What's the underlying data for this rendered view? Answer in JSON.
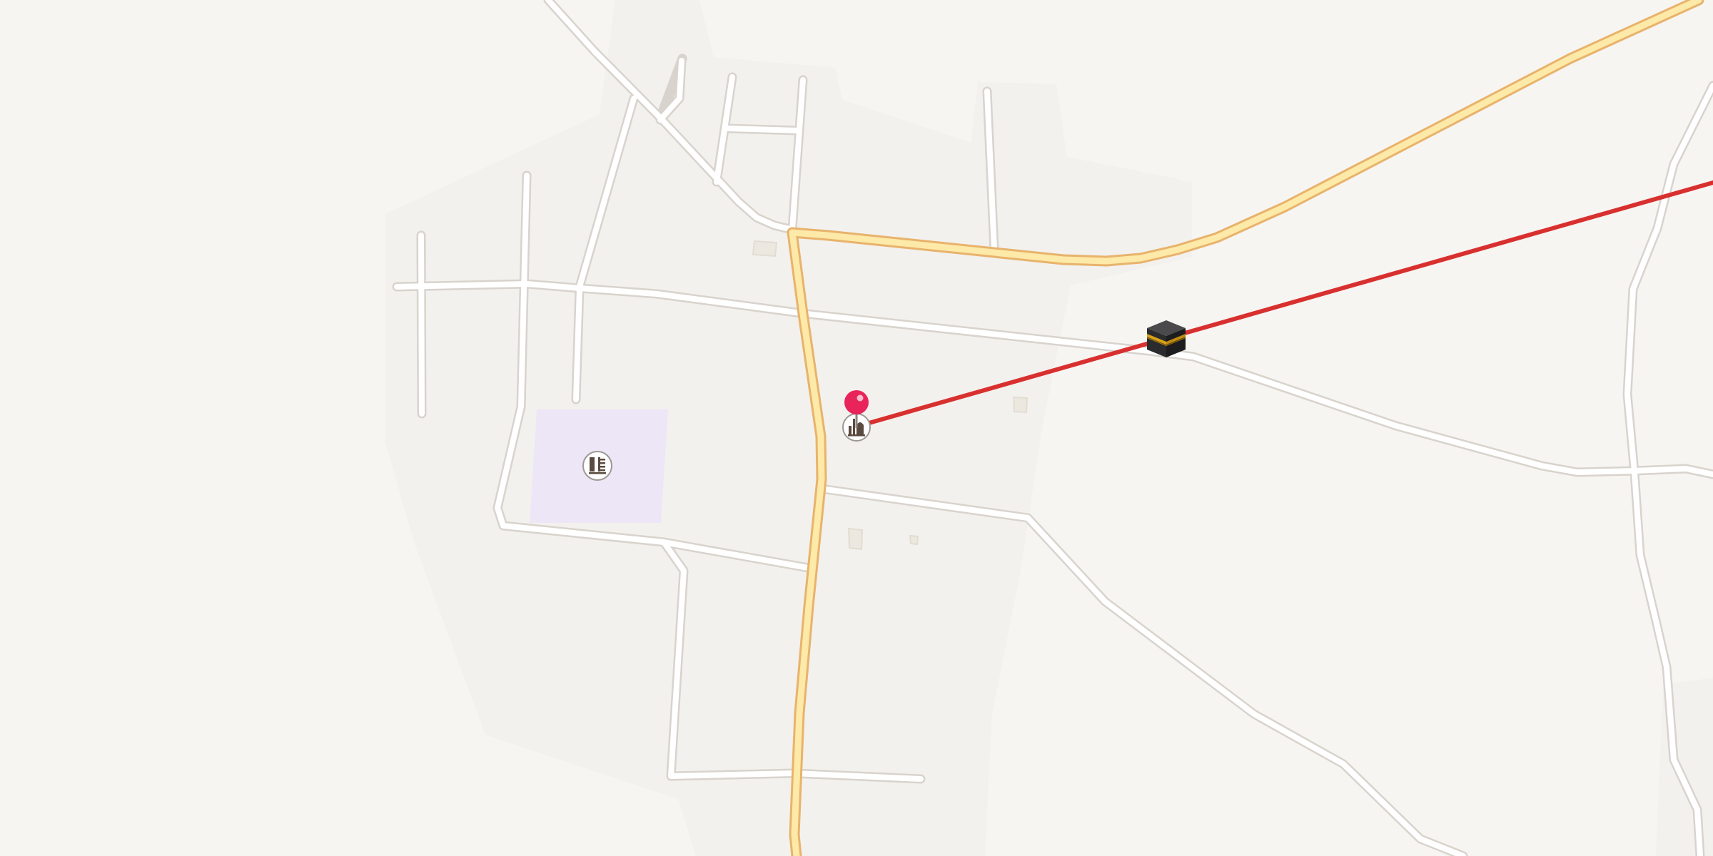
{
  "map": {
    "colors": {
      "land": "#f7f5f2",
      "area_tint": "#f2f0ed",
      "school_area": "#ede6f6",
      "road_fill": "#ffffff",
      "road_casing": "#d8d3cc",
      "major_road_fill": "#fde9a8",
      "major_road_casing": "#e8b36c",
      "qibla_line": "#d8302f",
      "pin": "#e8245a",
      "building": "#efece5"
    },
    "markers": {
      "location_pin": {
        "icon": "map-pin-icon",
        "color": "#e8245a"
      },
      "mosque_poi": {
        "icon": "mosque-icon"
      },
      "school_poi": {
        "icon": "school-icon"
      },
      "kaaba": {
        "icon": "kaaba-icon"
      }
    },
    "qibla_line": {
      "color": "#d8302f"
    }
  }
}
